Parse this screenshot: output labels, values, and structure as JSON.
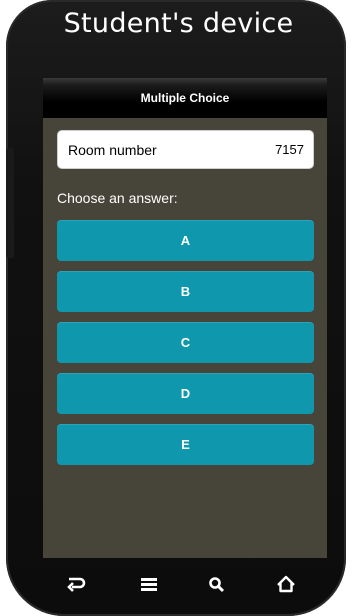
{
  "device": {
    "title": "Student's device"
  },
  "screen": {
    "header": "Multiple Choice",
    "room": {
      "label": "Room number",
      "value": "7157"
    },
    "prompt": "Choose an answer:",
    "answers": [
      "A",
      "B",
      "C",
      "D",
      "E"
    ]
  },
  "nav": {
    "icons": [
      "back-icon",
      "menu-icon",
      "search-icon",
      "home-icon"
    ]
  },
  "colors": {
    "screen_bg": "#474539",
    "answer_button": "#0f97ad",
    "phone_body": "#111111"
  }
}
